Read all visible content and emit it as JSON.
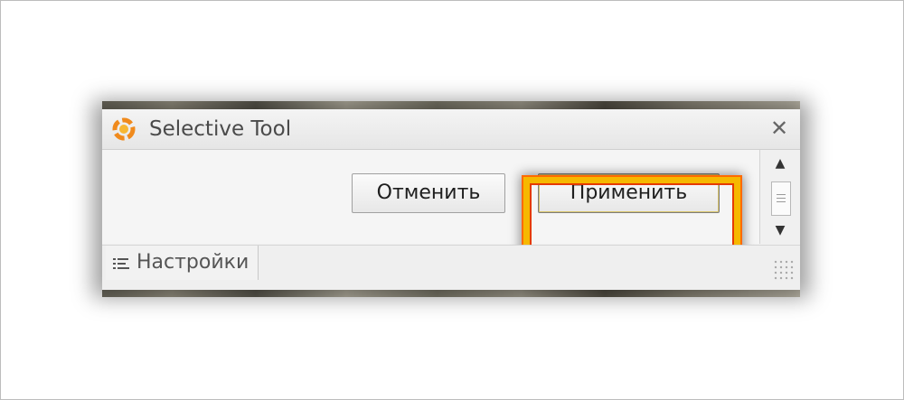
{
  "window": {
    "title": "Selective Tool",
    "close_glyph": "✕"
  },
  "buttons": {
    "cancel_label": "Отменить",
    "apply_label": "Применить"
  },
  "scrollbar": {
    "up_glyph": "▲",
    "down_glyph": "▼"
  },
  "tabs": [
    {
      "label": "Настройки",
      "icon": "settings-list-icon"
    }
  ],
  "colors": {
    "highlight_outer": "#f6b800",
    "highlight_inner": "#e53a00",
    "app_icon_orange": "#f08a1c"
  }
}
